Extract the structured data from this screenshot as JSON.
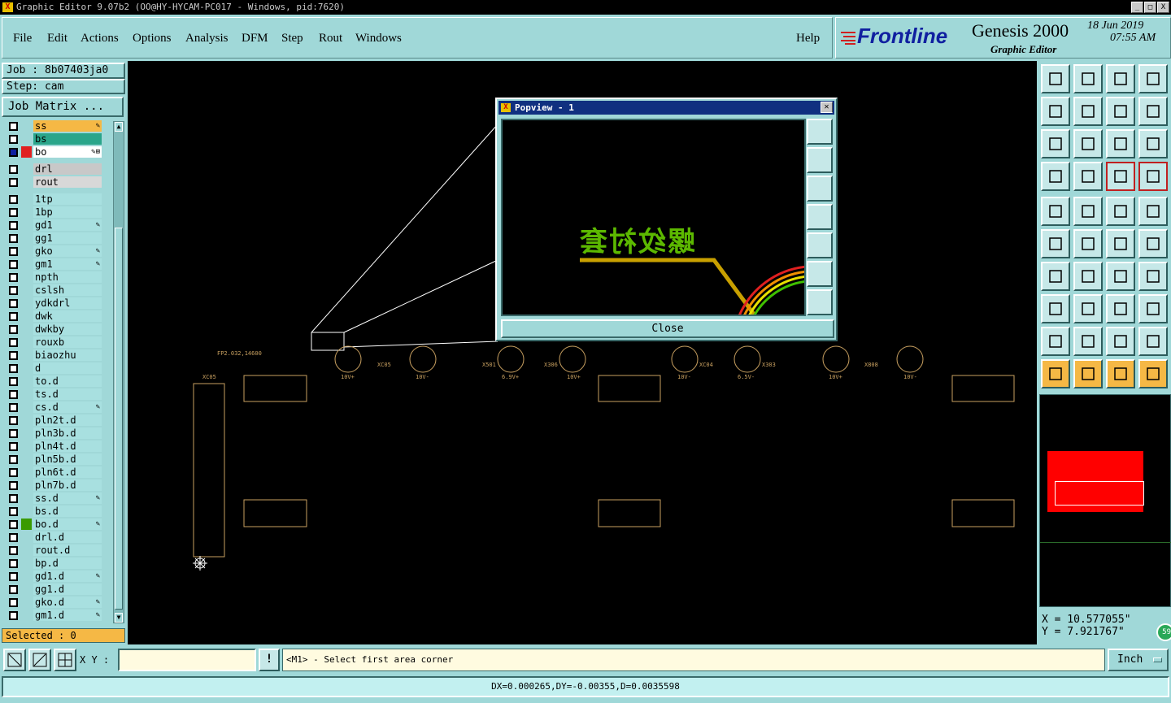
{
  "window": {
    "title": "Graphic Editor 9.07b2 (OO@HY-HYCAM-PC017 - Windows, pid:7620)",
    "controls": [
      "_",
      "□",
      "X"
    ]
  },
  "menu": {
    "items": [
      "File",
      "Edit",
      "Actions",
      "Options",
      "Analysis",
      "DFM",
      "Step",
      "Rout",
      "Windows"
    ],
    "help": "Help"
  },
  "brand": {
    "logo": "Frontline",
    "product": "Genesis 2000",
    "subtitle": "Graphic Editor",
    "date": "18 Jun 2019",
    "time": "07:55 AM"
  },
  "job": {
    "label": "Job : 8b07403ja0",
    "step": "Step: cam",
    "matrix_button": "Job Matrix ..."
  },
  "layers": [
    {
      "name": "ss",
      "color": "#f5b845",
      "mark": "✎"
    },
    {
      "name": "bs",
      "color": "#2aa58a",
      "mark": ""
    },
    {
      "name": "bo",
      "color": "#ffffff",
      "mark": "✎⊞",
      "active": true
    },
    {
      "name": "drl",
      "color": "#c8c8c8",
      "mark": ""
    },
    {
      "name": "rout",
      "color": "#d8d8d8",
      "mark": ""
    },
    {
      "name": "1tp",
      "color": "#a8e0e0",
      "mark": ""
    },
    {
      "name": "1bp",
      "color": "#a8e0e0",
      "mark": ""
    },
    {
      "name": "gd1",
      "color": "#a8e0e0",
      "mark": "✎"
    },
    {
      "name": "gg1",
      "color": "#a8e0e0",
      "mark": ""
    },
    {
      "name": "gko",
      "color": "#a8e0e0",
      "mark": "✎"
    },
    {
      "name": "gm1",
      "color": "#a8e0e0",
      "mark": "✎"
    },
    {
      "name": "npth",
      "color": "#a8e0e0",
      "mark": ""
    },
    {
      "name": "cslsh",
      "color": "#a8e0e0",
      "mark": ""
    },
    {
      "name": "ydkdrl",
      "color": "#a8e0e0",
      "mark": ""
    },
    {
      "name": "dwk",
      "color": "#a8e0e0",
      "mark": ""
    },
    {
      "name": "dwkby",
      "color": "#a8e0e0",
      "mark": ""
    },
    {
      "name": "rouxb",
      "color": "#a8e0e0",
      "mark": ""
    },
    {
      "name": "biaozhu",
      "color": "#a8e0e0",
      "mark": ""
    },
    {
      "name": "d",
      "color": "#a8e0e0",
      "mark": ""
    },
    {
      "name": "to.d",
      "color": "#a8e0e0",
      "mark": ""
    },
    {
      "name": "ts.d",
      "color": "#a8e0e0",
      "mark": ""
    },
    {
      "name": "cs.d",
      "color": "#a8e0e0",
      "mark": "✎"
    },
    {
      "name": "pln2t.d",
      "color": "#a8e0e0",
      "mark": ""
    },
    {
      "name": "pln3b.d",
      "color": "#a8e0e0",
      "mark": ""
    },
    {
      "name": "pln4t.d",
      "color": "#a8e0e0",
      "mark": ""
    },
    {
      "name": "pln5b.d",
      "color": "#a8e0e0",
      "mark": ""
    },
    {
      "name": "pln6t.d",
      "color": "#a8e0e0",
      "mark": ""
    },
    {
      "name": "pln7b.d",
      "color": "#a8e0e0",
      "mark": ""
    },
    {
      "name": "ss.d",
      "color": "#a8e0e0",
      "mark": "✎"
    },
    {
      "name": "bs.d",
      "color": "#a8e0e0",
      "mark": ""
    },
    {
      "name": "bo.d",
      "color": "#a8e0e0",
      "mark": "✎"
    },
    {
      "name": "drl.d",
      "color": "#a8e0e0",
      "mark": ""
    },
    {
      "name": "rout.d",
      "color": "#a8e0e0",
      "mark": ""
    },
    {
      "name": "bp.d",
      "color": "#a8e0e0",
      "mark": ""
    },
    {
      "name": "gd1.d",
      "color": "#a8e0e0",
      "mark": "✎"
    },
    {
      "name": "gg1.d",
      "color": "#a8e0e0",
      "mark": ""
    },
    {
      "name": "gko.d",
      "color": "#a8e0e0",
      "mark": "✎"
    },
    {
      "name": "gm1.d",
      "color": "#a8e0e0",
      "mark": "✎"
    }
  ],
  "selected": "Selected : 0",
  "popup": {
    "title": "Popview - 1",
    "text": "螺纹衬套",
    "close": "Close"
  },
  "canvas": {
    "texts": [
      "FP2.032,14600",
      "XC05",
      "XC05",
      "X501",
      "X306",
      "XC04",
      "X303",
      "X808",
      "10V+",
      "10V-",
      "6.9V+",
      "10V+",
      "10V-",
      "6.5V-",
      "10V+",
      "10V-"
    ]
  },
  "coords": {
    "x": "X  =  10.577055\"",
    "y": "Y  =  7.921767\""
  },
  "badge": "59",
  "bottom": {
    "xy_label": "X Y :",
    "prompt": "<M1> - Select first area corner",
    "units": "Inch",
    "status": "DX=0.000265,DY=-0.00355,D=0.0035598"
  },
  "colors": {
    "panel": "#a0d8d8",
    "canvas": "#000000",
    "highlight": "#f5b845",
    "silk": "#5cb800",
    "outline": "#c8a060"
  }
}
